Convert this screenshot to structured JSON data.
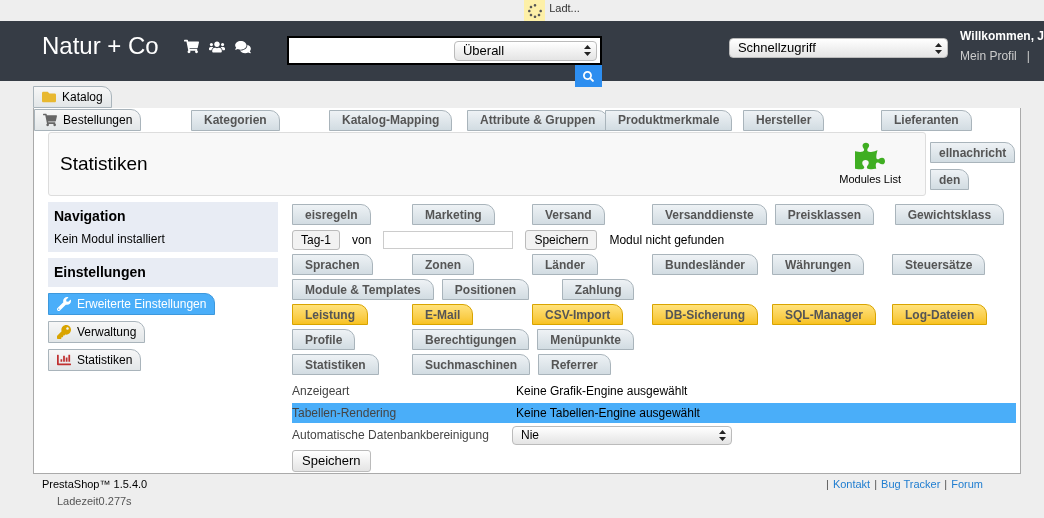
{
  "loader": {
    "text": "Ladt..."
  },
  "header": {
    "logo": "Natur + Co",
    "search": {
      "scope": "Überall"
    },
    "quick_access": "Schnellzugriff",
    "welcome": "Willkommen, J",
    "profile_link": "Mein Profil",
    "separator": "|"
  },
  "main_tabs": [
    {
      "label": "Katalog",
      "selected": false
    },
    {
      "label": "Bestellungen",
      "selected": false
    },
    {
      "label": "Erweiterte Einstellungen",
      "selected": true
    },
    {
      "label": "Verwaltung",
      "selected": false
    },
    {
      "label": "Statistiken",
      "selected": false
    }
  ],
  "submenus": [
    {
      "active": false,
      "items": [
        "Kategorien",
        "Katalog-Mapping",
        "Attribute & Gruppen",
        "Produktmerkmale",
        "Hersteller",
        "Lieferanten"
      ]
    },
    {
      "active": false,
      "items": [
        "eisregeln",
        "Marketing",
        "Versand",
        "Versanddienste",
        "Preisklassen",
        "Gewichtsklass"
      ]
    },
    {
      "active": false,
      "items": [
        "Sprachen",
        "Zonen",
        "Länder",
        "Bundesländer",
        "Währungen",
        "Steuersätze"
      ]
    },
    {
      "active": false,
      "items": [
        "Module & Templates",
        "Positionen",
        "Zahlung"
      ]
    },
    {
      "active": true,
      "items": [
        "Leistung",
        "E-Mail",
        "CSV-Import",
        "DB-Sicherung",
        "SQL-Manager",
        "Log-Dateien"
      ]
    },
    {
      "active": false,
      "items": [
        "Profile",
        "Berechtigungen",
        "Menüpunkte"
      ]
    },
    {
      "active": false,
      "items": [
        "Statistiken",
        "Suchmaschinen",
        "Referrer"
      ]
    }
  ],
  "overflow_tabs": [
    "ellnachricht",
    "den"
  ],
  "panel": {
    "title": "Statistiken",
    "toolbar_button": "Modules List"
  },
  "stats_toolbar": {
    "period_button": "Tag-1",
    "from_label": "von",
    "save_button": "Speichern",
    "message": "Modul nicht gefunden"
  },
  "sidebar": {
    "navigation": {
      "title": "Navigation",
      "text": "Kein Modul installiert"
    },
    "settings_title": "Einstellungen"
  },
  "settings": {
    "fields": [
      {
        "kind": "text",
        "label": "Anzeigeart",
        "value": "Keine Grafik-Engine ausgewählt",
        "highlighted": false
      },
      {
        "kind": "text",
        "label": "Tabellen-Rendering",
        "value": "Keine Tabellen-Engine ausgewählt",
        "highlighted": true
      },
      {
        "kind": "select",
        "label": "Automatische Datenbankbereinigung",
        "value": "Nie",
        "highlighted": false
      }
    ],
    "save_button": "Speichern"
  },
  "footer": {
    "version": "PrestaShop™ 1.5.4.0",
    "load_time": "Ladezeit0.277s",
    "links": [
      {
        "separator": "|",
        "label": "Kontakt"
      },
      {
        "separator": "|",
        "label": "Bug Tracker"
      },
      {
        "separator": "|",
        "label": "Forum"
      }
    ]
  }
}
